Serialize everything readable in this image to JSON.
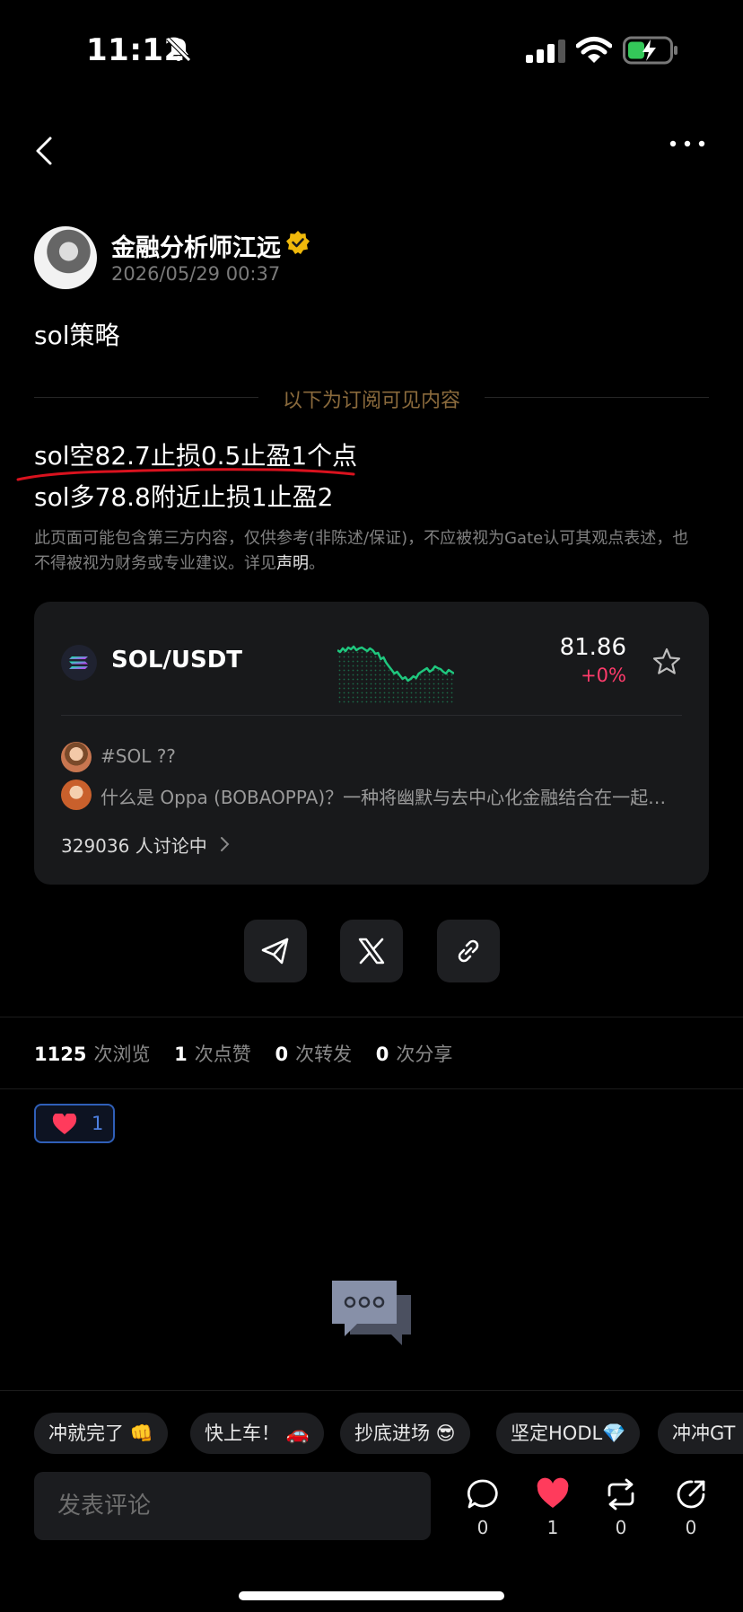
{
  "status_bar": {
    "time": "11:12"
  },
  "post": {
    "author": "金融分析师江远",
    "date": "2026/05/29 00:37",
    "title": "sol策略",
    "divider_text": "以下为订阅可见内容",
    "lines": [
      "sol空82.7止损0.5止盈1个点",
      "sol多78.8附近止损1止盈2"
    ],
    "disclaimer": "此页面可能包含第三方内容，仅供参考(非陈述/保证)，不应被视为Gate认可其观点表述，也不得被视为财务或专业建议。详见",
    "disclaimer_link": "声明",
    "disclaimer_end": "。"
  },
  "market_card": {
    "pair": "SOL/USDT",
    "price": "81.86",
    "change": "+0%",
    "change_color": "#ff3b6b",
    "sparkline_color": "#1fc77e",
    "topics": [
      "#SOL ??",
      "什么是 Oppa (BOBAOPPA)？一种将幽默与去中心化金融结合在一起的代币"
    ],
    "discuss": "329036 人讨论中"
  },
  "share_buttons": [
    "telegram-icon",
    "x-icon",
    "link-icon"
  ],
  "stats": [
    {
      "num": "1125",
      "label": "次浏览"
    },
    {
      "num": "1",
      "label": "次点赞"
    },
    {
      "num": "0",
      "label": "次转发"
    },
    {
      "num": "0",
      "label": "次分享"
    }
  ],
  "reaction": {
    "count": "1"
  },
  "quick_replies": [
    "冲就完了 👊",
    "快上车！ 🚗",
    "抄底进场 😎",
    "坚定HODL💎",
    "冲冲GT"
  ],
  "comment": {
    "placeholder": "发表评论"
  },
  "actions": {
    "comment": "0",
    "like": "1",
    "repost": "0",
    "share": "0"
  },
  "colors": {
    "accent_blue": "#2f5fb8",
    "like_red": "#ff3b5c",
    "divider_gold": "#8a6a3c"
  }
}
